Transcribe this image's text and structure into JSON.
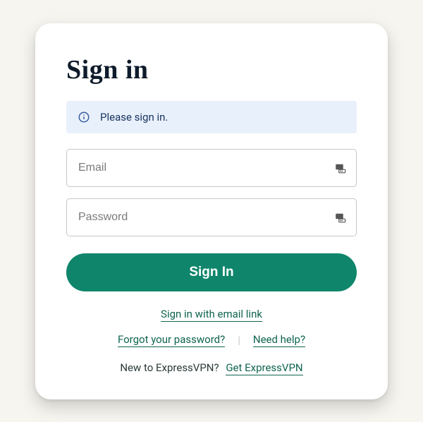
{
  "title": "Sign in",
  "notice": {
    "message": "Please sign in."
  },
  "fields": {
    "email_placeholder": "Email",
    "password_placeholder": "Password"
  },
  "buttons": {
    "signin": "Sign In"
  },
  "links": {
    "email_link": "Sign in with email link",
    "forgot": "Forgot your password?",
    "help": "Need help?",
    "get": "Get ExpressVPN"
  },
  "cta": {
    "prompt": "New to ExpressVPN?"
  },
  "separator": "|"
}
